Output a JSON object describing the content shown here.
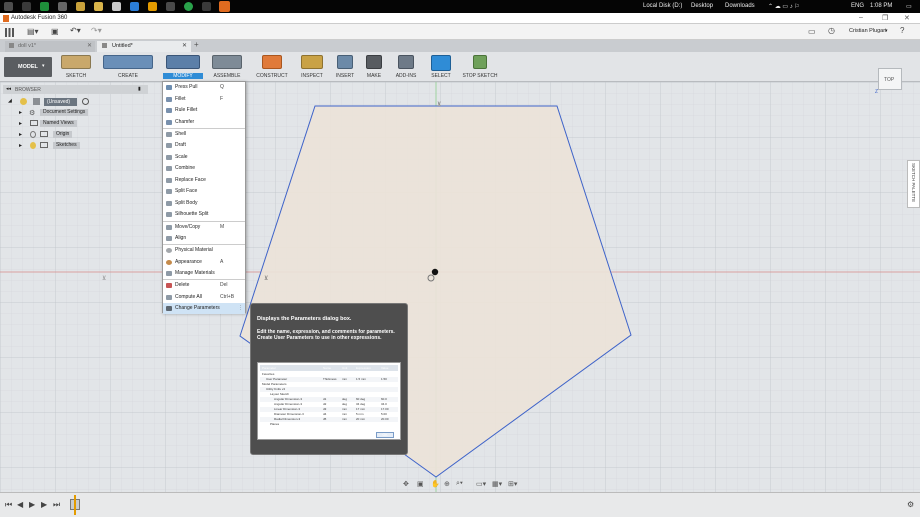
{
  "taskbar": {
    "drive": "Local Disk (D:)",
    "desktop": "Desktop",
    "downloads": "Downloads",
    "lang": "ENG",
    "time": "1:08 PM"
  },
  "app": {
    "title": "Autodesk Fusion 360",
    "user": "Cristian Plugari"
  },
  "tabs": [
    {
      "label": "doll v1*"
    },
    {
      "label": "Untitled*"
    }
  ],
  "workspace": {
    "label": "MODEL"
  },
  "toolbar": {
    "sketch": "SKETCH",
    "create": "CREATE",
    "modify": "MODIFY",
    "assemble": "ASSEMBLE",
    "construct": "CONSTRUCT",
    "inspect": "INSPECT",
    "insert": "INSERT",
    "make": "MAKE",
    "addins": "ADD-INS",
    "select": "SELECT",
    "stop_sketch": "STOP SKETCH"
  },
  "browser": {
    "title": "BROWSER",
    "root": "(Unsaved)",
    "items": [
      "Document Settings",
      "Named Views",
      "Origin",
      "Sketches"
    ]
  },
  "modify_menu": {
    "groups": [
      [
        {
          "label": "Press Pull",
          "shortcut": "Q"
        },
        {
          "label": "Fillet",
          "shortcut": "F"
        },
        {
          "label": "Rule Fillet",
          "shortcut": ""
        },
        {
          "label": "Chamfer",
          "shortcut": ""
        }
      ],
      [
        {
          "label": "Shell",
          "shortcut": ""
        },
        {
          "label": "Draft",
          "shortcut": ""
        },
        {
          "label": "Scale",
          "shortcut": ""
        },
        {
          "label": "Combine",
          "shortcut": ""
        },
        {
          "label": "Replace Face",
          "shortcut": ""
        },
        {
          "label": "Split Face",
          "shortcut": ""
        },
        {
          "label": "Split Body",
          "shortcut": ""
        },
        {
          "label": "Silhouette Split",
          "shortcut": ""
        }
      ],
      [
        {
          "label": "Move/Copy",
          "shortcut": "M"
        },
        {
          "label": "Align",
          "shortcut": ""
        }
      ],
      [
        {
          "label": "Physical Material",
          "shortcut": ""
        },
        {
          "label": "Appearance",
          "shortcut": "A"
        },
        {
          "label": "Manage Materials",
          "shortcut": ""
        }
      ],
      [
        {
          "label": "Delete",
          "shortcut": "Del"
        },
        {
          "label": "Compute All",
          "shortcut": "Ctrl+B"
        },
        {
          "label": "Change Parameters",
          "shortcut": ""
        }
      ]
    ]
  },
  "tooltip": {
    "title": "Displays the Parameters dialog box.",
    "body": "Edit the name, expression, and comments for parameters. Create User Parameters to use in other expressions.",
    "preview": {
      "headers": [
        "Parameter",
        "Name",
        "Unit",
        "Expression",
        "Value"
      ],
      "rows": [
        [
          "Favorites",
          "",
          "",
          "",
          ""
        ],
        [
          "User Parameter",
          "Thickness",
          "mm",
          "1.5 mm",
          "1.50"
        ],
        [
          "Model Parameters",
          "",
          "",
          "",
          ""
        ],
        [
          "Utility Knife v4",
          "",
          "",
          "",
          ""
        ],
        [
          "Layout Sketch",
          "",
          "",
          "",
          ""
        ],
        [
          "Angular Dimension-3",
          "d1",
          "deg",
          "60 deg",
          "60.0"
        ],
        [
          "Angular Dimension-3",
          "d2",
          "deg",
          "34 deg",
          "34.0"
        ],
        [
          "Linear Dimension-3",
          "d3",
          "mm",
          "17 mm",
          "17.00"
        ],
        [
          "Diameter Dimension-3",
          "d4",
          "mm",
          "5 mm",
          "5.00"
        ],
        [
          "Radial Dimension-3",
          "d5",
          "mm",
          "20 mm",
          "20.00"
        ],
        [
          "Planes",
          "",
          "",
          "",
          ""
        ]
      ],
      "ok": "OK"
    }
  },
  "viewcube": {
    "label": "TOP"
  },
  "palette": {
    "label": "SKETCH PALETTE"
  },
  "colors": {
    "sketch_fill": "#ece3d8",
    "sketch_line": "#3e63c9",
    "menu_highlight": "#cfe3f5",
    "toolbar_select": "#2f8cd6"
  }
}
